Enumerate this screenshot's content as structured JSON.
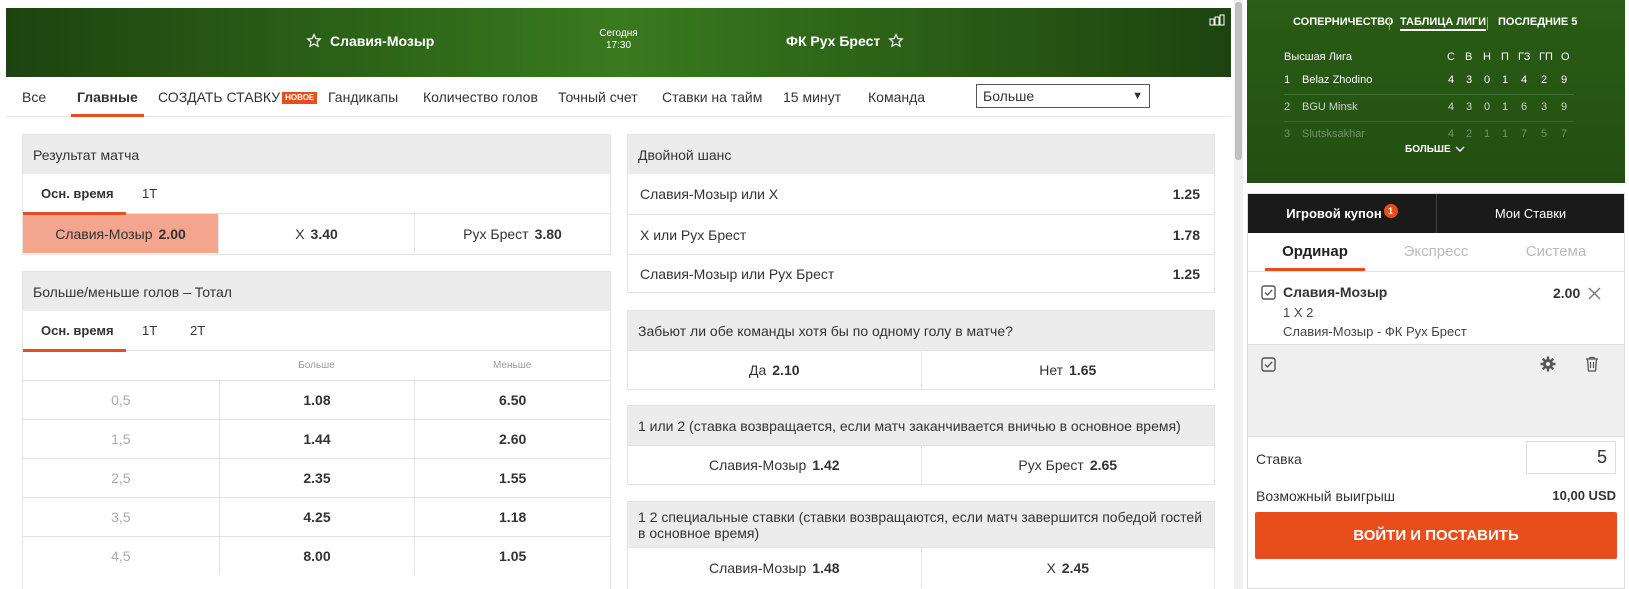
{
  "match": {
    "home": "Славия-Мозыр",
    "away": "ФК Рух Брест",
    "date_label": "Сегодня",
    "time": "17:30"
  },
  "tabs": {
    "all": "Все",
    "main": "Главные",
    "create_bet": "СОЗДАТЬ СТАВКУ",
    "new_badge": "НОВОЕ",
    "handicaps": "Гандикапы",
    "goals_count": "Количество голов",
    "exact_score": "Точный счет",
    "half_bets": "Ставки на тайм",
    "min15": "15 минут",
    "team": "Команда",
    "more_select": "Больше"
  },
  "result": {
    "title": "Результат матча",
    "subtabs": [
      "Осн. время",
      "1Т"
    ],
    "odds": [
      {
        "label": "Славия-Мозыр",
        "value": "2.00"
      },
      {
        "label": "X",
        "value": "3.40"
      },
      {
        "label": "Рух Брест",
        "value": "3.80"
      }
    ]
  },
  "totals": {
    "title": "Больше/меньше голов – Тотал",
    "subtabs": [
      "Осн. время",
      "1Т",
      "2Т"
    ],
    "col_over": "Больше",
    "col_under": "Меньше",
    "rows": [
      {
        "line": "0,5",
        "over": "1.08",
        "under": "6.50"
      },
      {
        "line": "1,5",
        "over": "1.44",
        "under": "2.60"
      },
      {
        "line": "2,5",
        "over": "2.35",
        "under": "1.55"
      },
      {
        "line": "3,5",
        "over": "4.25",
        "under": "1.18"
      },
      {
        "line": "4,5",
        "over": "8.00",
        "under": "1.05"
      }
    ]
  },
  "double_chance": {
    "title": "Двойной шанс",
    "rows": [
      {
        "label": "Славия-Мозыр или X",
        "value": "1.25"
      },
      {
        "label": "X или Рух Брест",
        "value": "1.78"
      },
      {
        "label": "Славия-Мозыр или Рух Брест",
        "value": "1.25"
      }
    ]
  },
  "btts": {
    "title": "Забьют ли обе команды хотя бы по одному голу в матче?",
    "odds": [
      {
        "label": "Да",
        "value": "2.10"
      },
      {
        "label": "Нет",
        "value": "1.65"
      }
    ]
  },
  "dnb": {
    "title": "1 или 2 (ставка возвращается, если матч заканчивается вничью в основное время)",
    "odds": [
      {
        "label": "Славия-Мозыр",
        "value": "1.42"
      },
      {
        "label": "Рух Брест",
        "value": "2.65"
      }
    ]
  },
  "special": {
    "title": "1 2 специальные ставки (ставки возвращаются, если матч завершится победой гостей в основное время)",
    "odds": [
      {
        "label": "Славия-Мозыр",
        "value": "1.48"
      },
      {
        "label": "X",
        "value": "2.45"
      }
    ]
  },
  "league": {
    "tabs": [
      "СОПЕРНИЧЕСТВО",
      "ТАБЛИЦА ЛИГИ",
      "ПОСЛЕДНИЕ 5"
    ],
    "name": "Высшая Лига",
    "cols": [
      "С",
      "В",
      "Н",
      "П",
      "ГЗ",
      "ГП",
      "О"
    ],
    "rows": [
      {
        "pos": "1",
        "team": "Belaz Zhodino",
        "vals": [
          "4",
          "3",
          "0",
          "1",
          "4",
          "2",
          "9"
        ]
      },
      {
        "pos": "2",
        "team": "BGU Minsk",
        "vals": [
          "4",
          "3",
          "0",
          "1",
          "6",
          "3",
          "9"
        ]
      },
      {
        "pos": "3",
        "team": "Slutsksakhar",
        "vals": [
          "4",
          "2",
          "1",
          "1",
          "7",
          "5",
          "7"
        ]
      }
    ],
    "more": "БОЛЬШЕ"
  },
  "coupon": {
    "tab_coupon": "Игровой купон",
    "count": "1",
    "tab_my_bets": "Мои Ставки",
    "types": [
      "Ординар",
      "Экспресс",
      "Система"
    ],
    "bet": {
      "selection": "Славия-Мозыр",
      "odds": "2.00",
      "market": "1 X 2",
      "event": "Славия-Мозыр - ФК Рух Брест"
    },
    "stake_label": "Ставка",
    "stake_value": "5",
    "payout_label": "Возможный выигрыш",
    "payout_value": "10,00 USD",
    "place_button": "ВОЙТИ И ПОСТАВИТЬ"
  },
  "colors": {
    "accent": "#e84e1b",
    "selected_odds": "#f3a58e",
    "header_green": "#2d6418"
  }
}
